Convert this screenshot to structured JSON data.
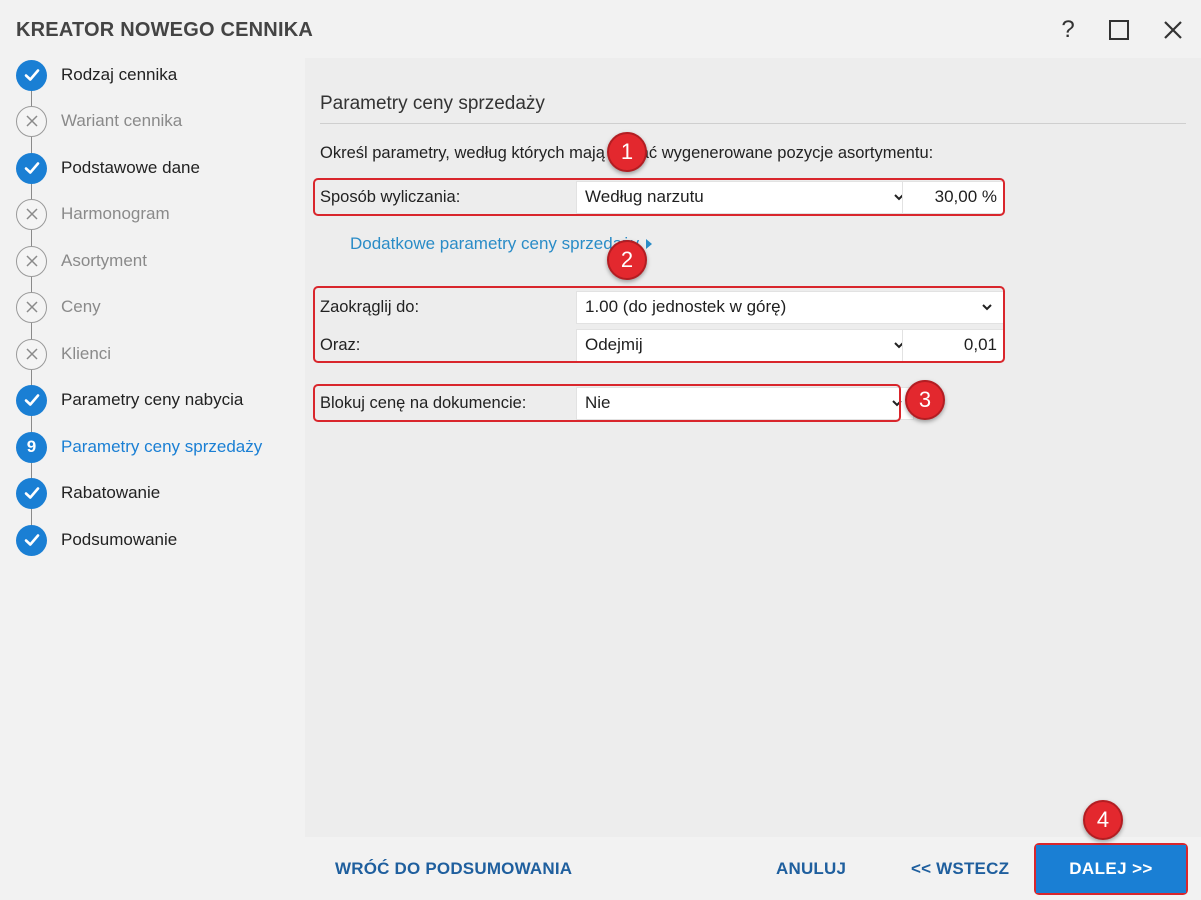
{
  "window": {
    "title": "KREATOR NOWEGO CENNIKA",
    "help": "?",
    "maximize": "☐",
    "close": "✕"
  },
  "steps": [
    {
      "label": "Rodzaj cennika",
      "state": "done"
    },
    {
      "label": "Wariant cennika",
      "state": "skipped"
    },
    {
      "label": "Podstawowe dane",
      "state": "done"
    },
    {
      "label": "Harmonogram",
      "state": "skipped"
    },
    {
      "label": "Asortyment",
      "state": "skipped"
    },
    {
      "label": "Ceny",
      "state": "skipped"
    },
    {
      "label": "Klienci",
      "state": "skipped"
    },
    {
      "label": "Parametry ceny nabycia",
      "state": "done"
    },
    {
      "label": "Parametry ceny sprzedaży",
      "state": "current",
      "number": "9"
    },
    {
      "label": "Rabatowanie",
      "state": "done"
    },
    {
      "label": "Podsumowanie",
      "state": "done"
    }
  ],
  "main": {
    "title": "Parametry ceny sprzedaży",
    "instruction": "Określ parametry, według których mają zostać wygenerowane pozycje asortymentu:",
    "calc_method": {
      "label": "Sposób wyliczania:",
      "value": "Według narzutu",
      "percent": "30,00 %"
    },
    "more_link": "Dodatkowe parametry ceny sprzedaży",
    "round_to": {
      "label": "Zaokrąglij do:",
      "value": "1.00 (do jednostek w górę)"
    },
    "and": {
      "label": "Oraz:",
      "value": "Odejmij",
      "amount": "0,01"
    },
    "lock_price": {
      "label": "Blokuj cenę na dokumencie:",
      "value": "Nie"
    }
  },
  "markers": [
    "1",
    "2",
    "3",
    "4"
  ],
  "footer": {
    "back_to_summary": "WRÓĆ DO PODSUMOWANIA",
    "cancel": "ANULUJ",
    "back": "<< WSTECZ",
    "next": "DALEJ >>"
  },
  "colors": {
    "accent": "#1a7fd4",
    "annotation_red": "#e3282e",
    "link": "#2a8cc7"
  }
}
